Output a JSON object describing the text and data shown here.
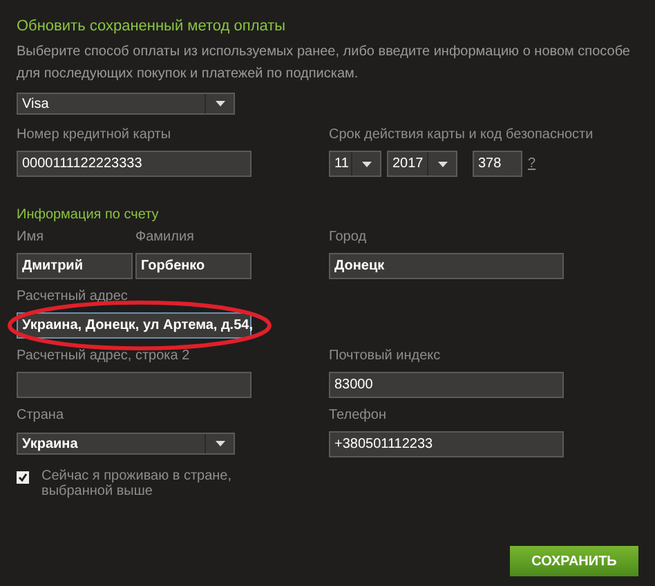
{
  "header": {
    "title": "Обновить сохраненный метод оплаты",
    "description": "Выберите способ оплаты из используемых ранее, либо введите информацию о новом способе для последующих покупок и платежей по подпискам."
  },
  "payment_method": {
    "value": "Visa"
  },
  "card": {
    "label": "Номер кредитной карты",
    "value": "0000111122223333"
  },
  "expiry": {
    "label": "Срок действия карты и код безопасности",
    "month": "11",
    "year": "2017",
    "cvv": "378",
    "help": "?"
  },
  "account": {
    "title": "Информация по счету",
    "first_name": {
      "label": "Имя",
      "value": "Дмитрий"
    },
    "last_name": {
      "label": "Фамилия",
      "value": "Горбенко"
    },
    "city": {
      "label": "Город",
      "value": "Донецк"
    },
    "address": {
      "label": "Расчетный адрес",
      "value": "Украина, Донецк, ул Артема, д.54,",
      "highlighted": true
    },
    "address2": {
      "label": "Расчетный адрес, строка 2"
    },
    "zip": {
      "label": "Почтовый индекс",
      "value": "83000"
    },
    "country": {
      "label": "Страна",
      "value": "Украина"
    },
    "phone": {
      "label": "Телефон",
      "value": "+380501112233"
    },
    "resident": {
      "label": "Сейчас я проживаю в стране, выбранной выше",
      "checked": true
    }
  },
  "save_button": {
    "label": "СОХРАНИТЬ"
  }
}
